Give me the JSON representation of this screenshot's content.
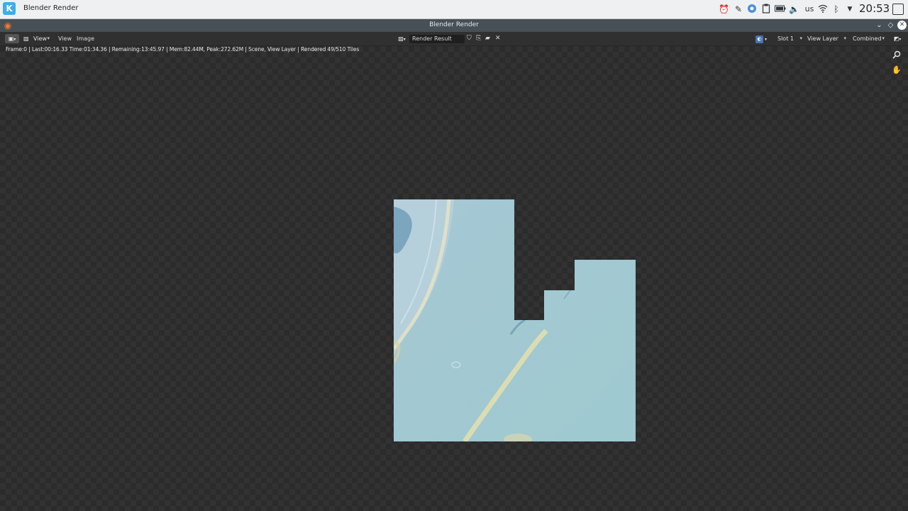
{
  "taskbar": {
    "active_task": "Blender Render",
    "keyboard_layout": "us",
    "clock": "20:53",
    "tray_icons": [
      "notification-icon",
      "update-icon",
      "chrome-icon",
      "clipboard-icon",
      "battery-icon",
      "volume-icon",
      "wifi-icon",
      "bluetooth-icon",
      "expand-tray-icon"
    ]
  },
  "window": {
    "title": "Blender Render"
  },
  "header": {
    "menus": [
      "View",
      "View",
      "Image"
    ],
    "image_name": "Render Result",
    "slot": "Slot 1",
    "view_layer": "View Layer",
    "pass": "Combined"
  },
  "viewport": {
    "status": "Frame:0 | Last:00:16.33 Time:01:34.36 | Remaining:13:45.97 | Mem:82.44M, Peak:272.62M | Scene, View Layer | Rendered 49/510 Tiles"
  },
  "colors": {
    "render_fill": "#a2c9d2",
    "checker_dark": "#2b2b2b",
    "checker_light": "#323232",
    "accent": "#3daee9"
  }
}
